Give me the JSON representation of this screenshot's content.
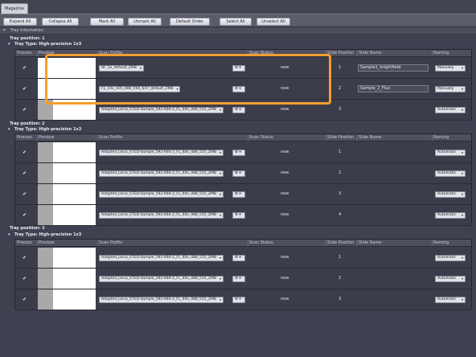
{
  "tab": {
    "label": "Magazine"
  },
  "toolbar": {
    "expand_all": "Expand All",
    "collapse_all": "Collapse All",
    "mark_all": "Mark All",
    "unmark_all": "Unmark All",
    "default_order": "Default Order",
    "select_all": "Select All",
    "unselect_all": "Unselect All"
  },
  "tray_info": "Tray information",
  "columns": {
    "process": "Process",
    "preview": "Preview",
    "scan_profile": "Scan Profile",
    "scan_status": "Scan Status",
    "slide_position": "Slide Position",
    "slide_name": "Slide Name",
    "naming": "Naming"
  },
  "trays": [
    {
      "position": "Tray position:  1",
      "type": "Tray Type:  High-precision 1x3",
      "rows": [
        {
          "check": "✔",
          "profile": "BF_5x_default_ZMB",
          "option": "⚙ ▾",
          "status": "new",
          "slide_position": "1",
          "slide_name": "Sample1_brightfield",
          "naming": "Manually"
        },
        {
          "check": "✔",
          "profile": "FL_10x_405_488_594_647_default_ZMB",
          "option": "⚙ ▾",
          "status": "new",
          "slide_position": "2",
          "slide_name": "Sample_2_Fluo",
          "naming": "Manually"
        },
        {
          "check": "✔",
          "profile": "Adapted_Leica_STED-Sample_592-660-2_FL_40x_488_555_ZMB",
          "option": "⚙ ▾",
          "status": "new",
          "slide_position": "3",
          "slide_name": "",
          "naming": "Automatic"
        }
      ]
    },
    {
      "position": "Tray position:  2",
      "type": "Tray Type:  High-precision 1x3",
      "rows": [
        {
          "check": "✔",
          "profile": "Adapted_Leica_STED-Sample_592-660-2_FL_40x_488_555_ZMB",
          "option": "⚙ ▾",
          "status": "new",
          "slide_position": "1",
          "slide_name": "",
          "naming": "Automatic"
        },
        {
          "check": "✔",
          "profile": "Adapted_Leica_STED-Sample_592-660-2_FL_40x_488_555_ZMB",
          "option": "⚙ ▾",
          "status": "new",
          "slide_position": "2",
          "slide_name": "",
          "naming": "Automatic"
        },
        {
          "check": "✔",
          "profile": "Adapted_Leica_STED-Sample_592-660-2_FL_40x_488_555_ZMB",
          "option": "⚙ ▾",
          "status": "new",
          "slide_position": "3",
          "slide_name": "",
          "naming": "Automatic"
        },
        {
          "check": "✔",
          "profile": "Adapted_Leica_STED-Sample_592-660-2_FL_40x_488_555_ZMB",
          "option": "⚙ ▾",
          "status": "new",
          "slide_position": "4",
          "slide_name": "",
          "naming": "Automatic"
        }
      ]
    },
    {
      "position": "Tray position:  3",
      "type": "Tray Type:  High-precision 1x3",
      "rows": [
        {
          "check": "✔",
          "profile": "Adapted_Leica_STED-Sample_592-660-2_FL_40x_488_555_ZMB",
          "option": "⚙ ▾",
          "status": "new",
          "slide_position": "1",
          "slide_name": "",
          "naming": "Automatic"
        },
        {
          "check": "✔",
          "profile": "Adapted_Leica_STED-Sample_592-660-2_FL_40x_488_555_ZMB",
          "option": "⚙ ▾",
          "status": "new",
          "slide_position": "2",
          "slide_name": "",
          "naming": "Automatic"
        },
        {
          "check": "✔",
          "profile": "Adapted_Leica_STED-Sample_592-660-2_FL_40x_488_555_ZMB",
          "option": "⚙ ▾",
          "status": "new",
          "slide_position": "3",
          "slide_name": "",
          "naming": "Automatic"
        }
      ]
    }
  ],
  "icons": {
    "dropdown": "chevron-down-icon",
    "settings": "gear-icon",
    "check": "checkmark-icon",
    "collapse": "triangle-down-icon"
  },
  "colors": {
    "highlight": "#f79d2e",
    "background": "#3f4150"
  }
}
